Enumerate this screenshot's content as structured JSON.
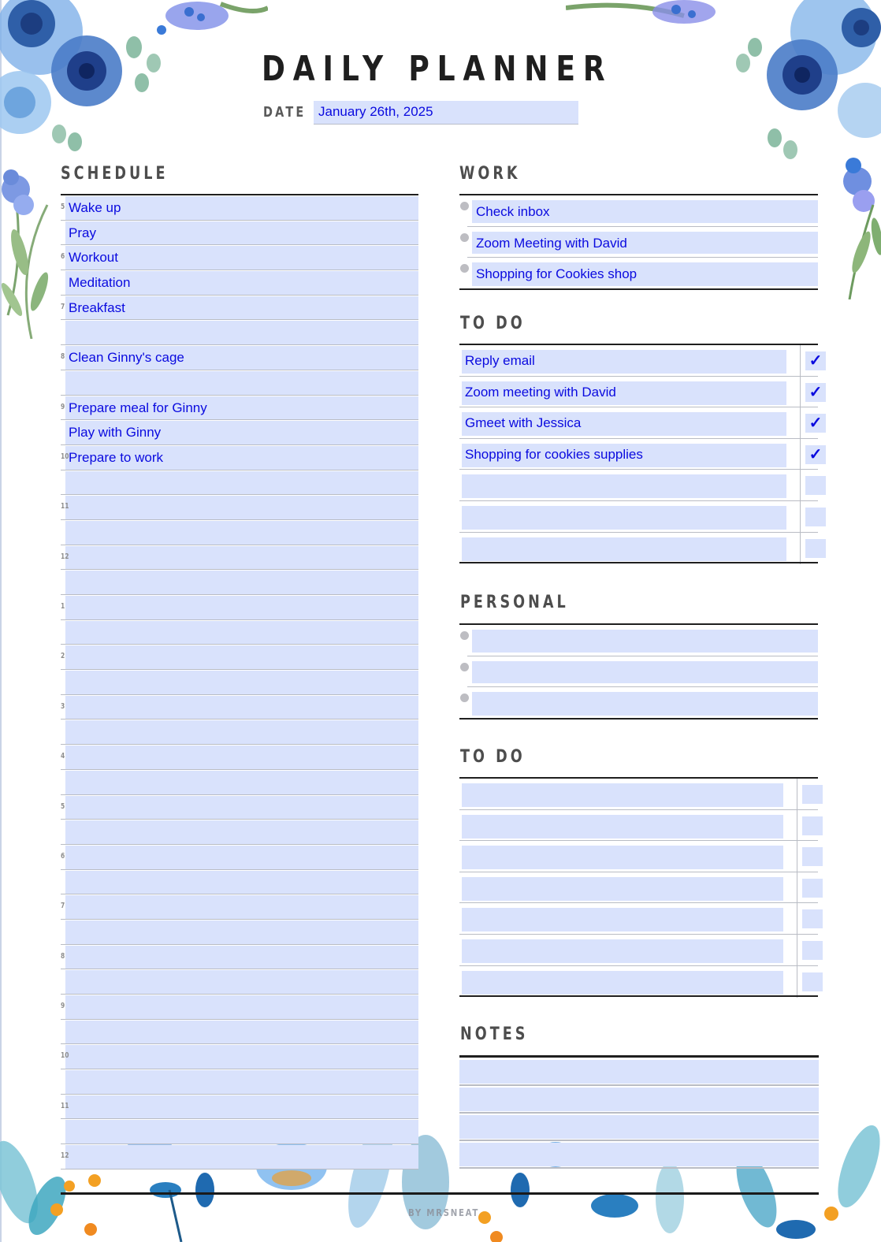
{
  "header": {
    "title": "DAILY PLANNER",
    "date_label": "DATE :",
    "date_value": "January 26th, 2025"
  },
  "schedule": {
    "title": "SCHEDULE",
    "rows": [
      {
        "hour": "5",
        "text": "Wake up"
      },
      {
        "hour": "",
        "text": "Pray"
      },
      {
        "hour": "6",
        "text": "Workout"
      },
      {
        "hour": "",
        "text": "Meditation"
      },
      {
        "hour": "7",
        "text": "Breakfast"
      },
      {
        "hour": "",
        "text": ""
      },
      {
        "hour": "8",
        "text": "Clean Ginny's cage"
      },
      {
        "hour": "",
        "text": ""
      },
      {
        "hour": "9",
        "text": "Prepare meal for Ginny"
      },
      {
        "hour": "",
        "text": "Play with Ginny"
      },
      {
        "hour": "10",
        "text": " Prepare to work"
      },
      {
        "hour": "",
        "text": ""
      },
      {
        "hour": "11",
        "text": ""
      },
      {
        "hour": "",
        "text": ""
      },
      {
        "hour": "12",
        "text": ""
      },
      {
        "hour": "",
        "text": ""
      },
      {
        "hour": "1",
        "text": ""
      },
      {
        "hour": "",
        "text": ""
      },
      {
        "hour": "2",
        "text": ""
      },
      {
        "hour": "",
        "text": ""
      },
      {
        "hour": "3",
        "text": ""
      },
      {
        "hour": "",
        "text": ""
      },
      {
        "hour": "4",
        "text": ""
      },
      {
        "hour": "",
        "text": ""
      },
      {
        "hour": "5",
        "text": ""
      },
      {
        "hour": "",
        "text": ""
      },
      {
        "hour": "6",
        "text": ""
      },
      {
        "hour": "",
        "text": ""
      },
      {
        "hour": "7",
        "text": ""
      },
      {
        "hour": "",
        "text": ""
      },
      {
        "hour": "8",
        "text": ""
      },
      {
        "hour": "",
        "text": ""
      },
      {
        "hour": "9",
        "text": ""
      },
      {
        "hour": "",
        "text": ""
      },
      {
        "hour": "10",
        "text": ""
      },
      {
        "hour": "",
        "text": ""
      },
      {
        "hour": "11",
        "text": ""
      },
      {
        "hour": "",
        "text": ""
      },
      {
        "hour": "12",
        "text": ""
      }
    ]
  },
  "work": {
    "title": "WORK",
    "items": [
      "Check inbox",
      "Zoom Meeting with David",
      "Shopping for Cookies shop"
    ]
  },
  "todo1": {
    "title": "TO DO",
    "items": [
      {
        "text": "Reply email",
        "checked": true
      },
      {
        "text": "Zoom meeting with David",
        "checked": true
      },
      {
        "text": "Gmeet with Jessica",
        "checked": true
      },
      {
        "text": "Shopping for cookies supplies",
        "checked": true
      },
      {
        "text": "",
        "checked": false
      },
      {
        "text": "",
        "checked": false
      },
      {
        "text": "",
        "checked": false
      }
    ]
  },
  "personal": {
    "title": "PERSONAL",
    "items": [
      "",
      "",
      ""
    ]
  },
  "todo2": {
    "title": "TO DO",
    "items": [
      {
        "text": "",
        "checked": false
      },
      {
        "text": "",
        "checked": false
      },
      {
        "text": "",
        "checked": false
      },
      {
        "text": "",
        "checked": false
      },
      {
        "text": "",
        "checked": false
      },
      {
        "text": "",
        "checked": false
      },
      {
        "text": "",
        "checked": false
      }
    ]
  },
  "notes": {
    "title": "NOTES",
    "lines": [
      "",
      "",
      "",
      ""
    ]
  },
  "footer": {
    "credit": "BY MRSNEAT"
  },
  "icons": {
    "check_glyph": "✓",
    "bullet": "bullet-dot"
  },
  "colors": {
    "field_fill": "#d9e2fc",
    "entry_text": "#0a0adf",
    "heading_text": "#4d4d4d"
  }
}
